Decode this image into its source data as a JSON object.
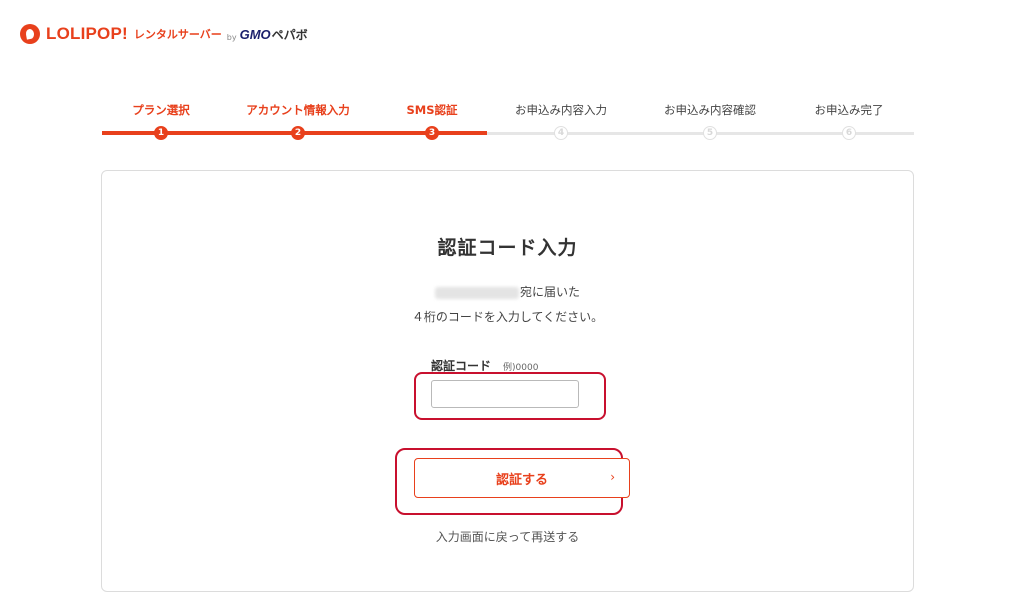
{
  "header": {
    "brand": "LOLIPOP!",
    "subtitle": "レンタルサーバー",
    "by": "by",
    "gmo": "GMO",
    "pepabo": "ペパボ"
  },
  "steps": [
    {
      "label": "プラン選択",
      "num": "1",
      "state": "done"
    },
    {
      "label": "アカウント情報入力",
      "num": "2",
      "state": "done"
    },
    {
      "label": "SMS認証",
      "num": "3",
      "state": "done"
    },
    {
      "label": "お申込み内容入力",
      "num": "4",
      "state": "todo"
    },
    {
      "label": "お申込み内容確認",
      "num": "5",
      "state": "todo"
    },
    {
      "label": "お申込み完了",
      "num": "6",
      "state": "todo"
    }
  ],
  "main": {
    "title": "認証コード入力",
    "desc_line1_suffix": "宛に届いた",
    "desc_line2": "４桁のコードを入力してください。",
    "field_label": "認証コード",
    "field_example": "例)0000",
    "input_value": "",
    "submit_label": "認証する",
    "submit_chevron": "›",
    "resend_link": "入力画面に戻って再送する"
  },
  "colors": {
    "accent": "#e8401c",
    "highlight": "#c8102e"
  }
}
